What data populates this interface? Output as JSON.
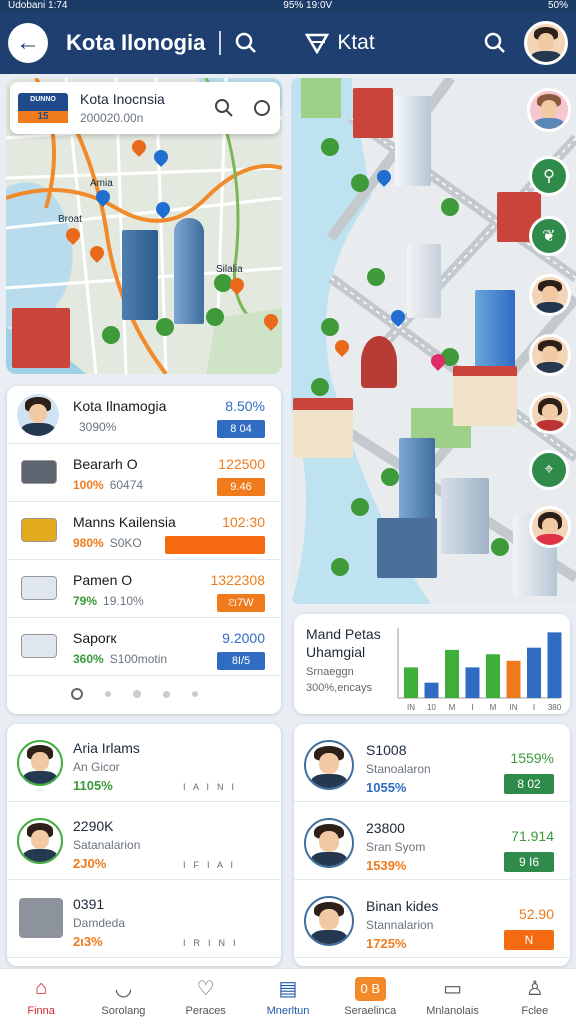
{
  "status": {
    "left": "Udobani 1:74",
    "center": "95% 19:0V",
    "right": "50%"
  },
  "appbar": {
    "title": "Kota Ilonogia",
    "tab": "Ktat"
  },
  "search": {
    "title": "Kota Inocnsia",
    "subtitle": "200020.00n",
    "flag_top": "DUNNO",
    "flag_bottom": "15"
  },
  "map_labels": {
    "a": "Amia",
    "b": "Broat",
    "c": "Silalia"
  },
  "list": [
    {
      "name": "Kota Ilnamogia",
      "sub_accent": "",
      "sub": "3090%",
      "value": "8.50%",
      "badge": "8 04",
      "badge_color": "#2f6cc2",
      "value_color": "#2f6cc2",
      "sub_color": "#6b7480"
    },
    {
      "name": "Beararh O",
      "sub_accent": "100%",
      "sub": "60474",
      "value": "122500",
      "badge": "9.46",
      "badge_color": "#ef7b1d",
      "value_color": "#ef7b1d",
      "sub_color": "#ef7b1d"
    },
    {
      "name": "Manns Kailensia",
      "sub_accent": "980%",
      "sub": "S0KO",
      "value": "102:30",
      "badge": "",
      "badge_color": "#f56a10",
      "value_color": "#ef7b1d",
      "sub_color": "#ef7b1d"
    },
    {
      "name": "Pamen O",
      "sub_accent": "79%",
      "sub": "19.10%",
      "value": "1322308",
      "badge": "ଅ7W",
      "badge_color": "#ef7b1d",
      "value_color": "#ef7b1d",
      "sub_color": "#3a9a3a"
    },
    {
      "name": "Saporк",
      "sub_accent": "360%",
      "sub": "S100motin",
      "value": "9.2000",
      "badge": "8Ι/5",
      "badge_color": "#2f6cc2",
      "value_color": "#2f6cc2",
      "sub_color": "#3a9a3a"
    }
  ],
  "chart": {
    "title": "Mand Petas",
    "subtitle": "Uhamgial",
    "line3": "Srnaeggn",
    "line4": "300%,encays"
  },
  "chart_data": {
    "type": "bar",
    "categories": [
      "IN",
      "10",
      "M",
      "I",
      "M",
      "IN",
      "I",
      "380"
    ],
    "values": [
      28,
      14,
      44,
      28,
      40,
      34,
      46,
      60
    ],
    "colors": [
      "#3fae3a",
      "#2f6cc2",
      "#3fae3a",
      "#2f6cc2",
      "#3fae3a",
      "#ef7b1d",
      "#2f6cc2",
      "#2f6cc2"
    ],
    "ylim": [
      0,
      64
    ]
  },
  "people_left": [
    {
      "name": "Aria Irlams",
      "sub": "An Gicor",
      "pct": "1105%",
      "pct_color": "#3a9a3a",
      "bars": [
        10,
        10,
        40,
        40
      ],
      "bar_colors": [
        "#3fae3a",
        "#2f6cc2",
        "#3fae3a",
        "#2e8b4a"
      ],
      "ticks": "I  A  I  N  I"
    },
    {
      "name": "2290K",
      "sub": "Satanalarion",
      "pct": "2J0%",
      "pct_color": "#ef7b1d",
      "bars": [
        4,
        4,
        40,
        22
      ],
      "bar_colors": [
        "#2f6cc2",
        "#2f6cc2",
        "#3fae3a",
        "#3fae3a"
      ],
      "ticks": "I  F  I  A  I"
    },
    {
      "name": "0391",
      "sub": "Damdeda",
      "pct": "2ι3%",
      "pct_color": "#ef7b1d",
      "bars": [
        2,
        2,
        38,
        38
      ],
      "bar_colors": [
        "#2f6cc2",
        "#2f6cc2",
        "#3fae3a",
        "#2e8b4a"
      ],
      "ticks": "I  R  I  N  I"
    }
  ],
  "people_right": [
    {
      "name": "S1008",
      "sub": "Stanoalaron",
      "pct": "1055%",
      "pct_color": "#2f6cc2",
      "value": "1559%",
      "value_color": "#3a9a3a",
      "badge": "8 02",
      "badge_color": "#2e8b4a"
    },
    {
      "name": "23800",
      "sub": "Sran Syom",
      "pct": "1539%",
      "pct_color": "#ef7b1d",
      "value": "71.914",
      "value_color": "#3a9a3a",
      "badge": "9 Ι6",
      "badge_color": "#2e8b4a"
    },
    {
      "name": "Binan kides",
      "sub": "Stannalarion",
      "pct": "1725%",
      "pct_color": "#ef7b1d",
      "value": "52.90",
      "value_color": "#ef7b1d",
      "badge": "N",
      "badge_color": "#f56a10"
    }
  ],
  "nav": [
    {
      "label": "Finna",
      "icon": "home-icon",
      "glyph": "⌂",
      "color": "#d62b2b"
    },
    {
      "label": "Sorolang",
      "icon": "bowl-icon",
      "glyph": "◡",
      "color": "#555"
    },
    {
      "label": "Peraces",
      "icon": "heart-icon",
      "glyph": "♡",
      "color": "#555"
    },
    {
      "label": "Mnerltun",
      "icon": "clipboard-icon",
      "glyph": "▤",
      "color": "#1f5aa8"
    },
    {
      "label": "Seraelinca",
      "icon": "ob-badge-icon",
      "glyph": "0 B",
      "color": "#555"
    },
    {
      "label": "Mnlanolais",
      "icon": "document-icon",
      "glyph": "▭",
      "color": "#555"
    },
    {
      "label": "Fclee",
      "icon": "user-icon",
      "glyph": "♙",
      "color": "#555"
    }
  ]
}
